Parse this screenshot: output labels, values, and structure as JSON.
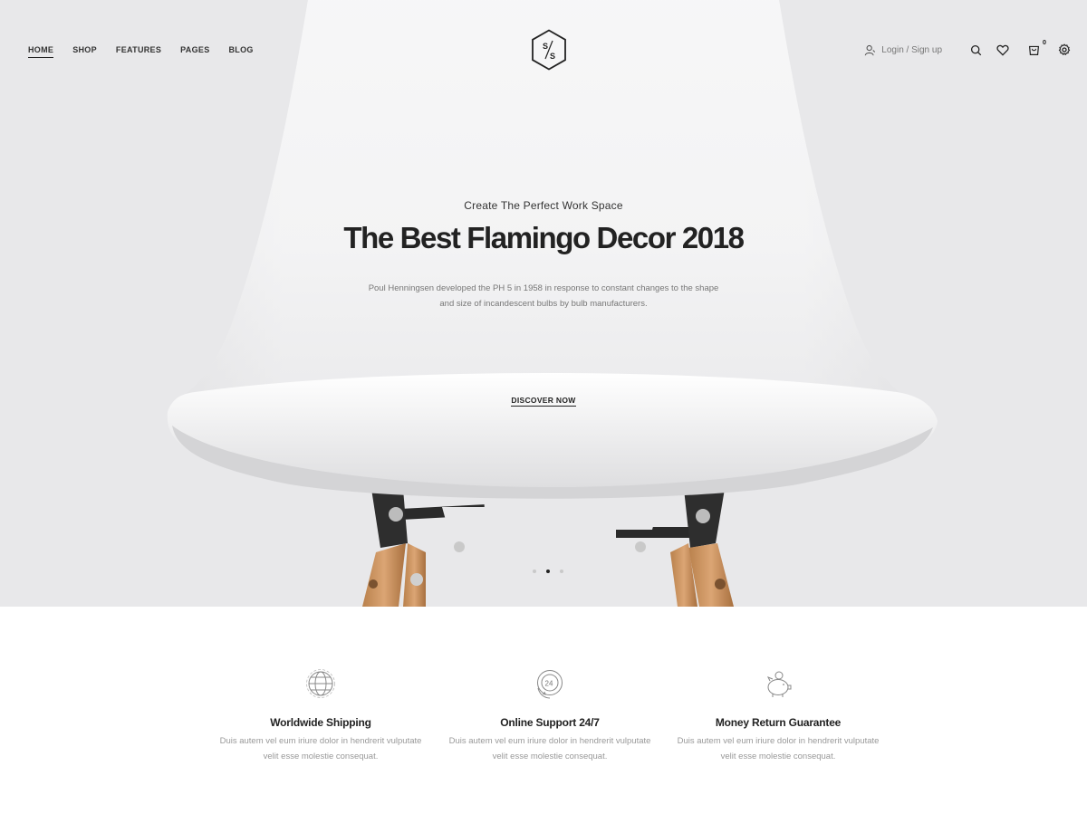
{
  "header": {
    "nav": [
      "HOME",
      "SHOP",
      "FEATURES",
      "PAGES",
      "BLOG"
    ],
    "logo_text": "S/S",
    "login_label": "Login / Sign up",
    "cart_count": "0",
    "icons": [
      "user-icon",
      "search-icon",
      "heart-icon",
      "cart-icon",
      "gear-icon"
    ]
  },
  "hero": {
    "kicker": "Create The Perfect Work Space",
    "headline": "The Best Flamingo Decor 2018",
    "description": "Poul Henningsen developed the PH 5 in 1958 in response to constant changes to the shape and size of incandescent bulbs by bulb manufacturers.",
    "cta_label": "DISCOVER NOW",
    "slide_count": 3,
    "active_slide": 2
  },
  "features": [
    {
      "icon": "globe-icon",
      "title": "Worldwide Shipping",
      "text": "Duis autem vel eum iriure dolor in hendrerit vulputate velit esse molestie consequat."
    },
    {
      "icon": "support-24-icon",
      "title": "Online Support 24/7",
      "text": "Duis autem vel eum iriure dolor in hendrerit vulputate velit esse molestie consequat."
    },
    {
      "icon": "piggy-bank-icon",
      "title": "Money Return Guarantee",
      "text": "Duis autem vel eum iriure dolor in hendrerit vulputate velit esse molestie consequat."
    }
  ],
  "colors": {
    "hero_bg": "#e8e8ea",
    "text_dark": "#222222",
    "text_muted": "#777777"
  }
}
